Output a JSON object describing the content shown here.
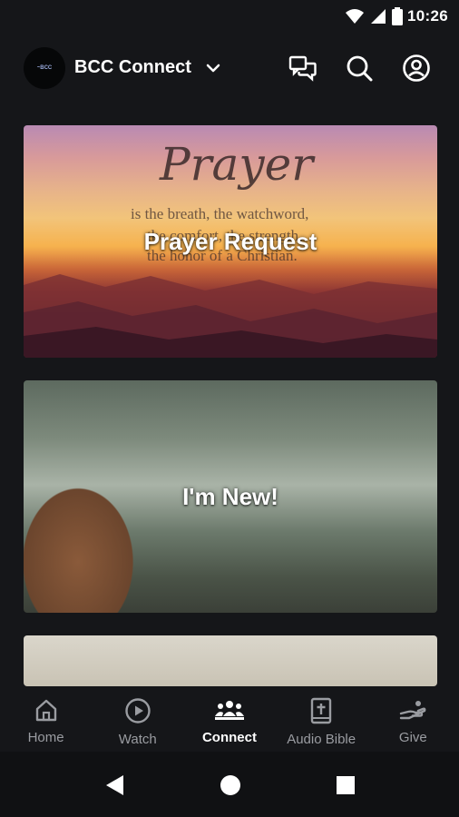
{
  "status_bar": {
    "time": "10:26"
  },
  "header": {
    "app_title": "BCC Connect",
    "logo_text": "~BCC"
  },
  "cards": [
    {
      "title": "Prayer Request",
      "image_text": {
        "script": "Prayer",
        "line1": "is the breath, the watchword,",
        "line2": "the comfort, the strength,",
        "line3": "the honor of a Christian."
      }
    },
    {
      "title": "I'm New!"
    },
    {
      "title": ""
    }
  ],
  "bottom_nav": {
    "items": [
      {
        "label": "Home",
        "icon": "home-icon"
      },
      {
        "label": "Watch",
        "icon": "play-circle-icon"
      },
      {
        "label": "Connect",
        "icon": "people-icon",
        "active": true
      },
      {
        "label": "Audio Bible",
        "icon": "bible-icon"
      },
      {
        "label": "Give",
        "icon": "give-hand-icon"
      }
    ]
  },
  "colors": {
    "background": "#151619",
    "active": "#ffffff",
    "inactive": "#9a9ca1"
  }
}
